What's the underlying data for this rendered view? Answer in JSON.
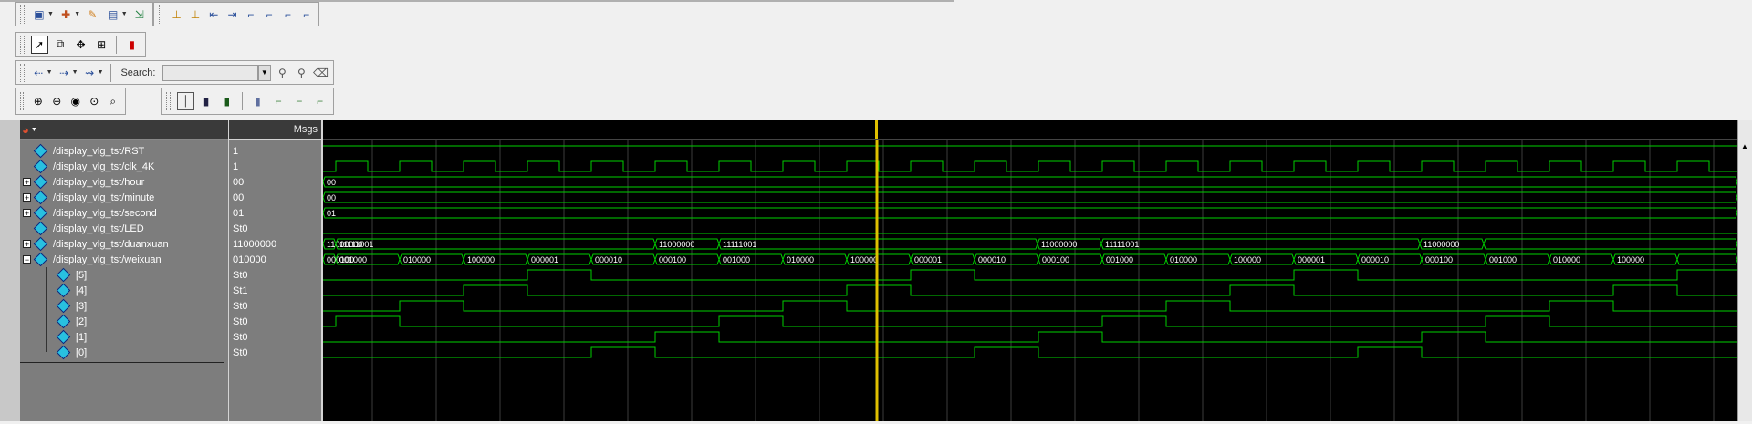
{
  "toolbars": {
    "row1_icons": [
      "new-wave-icon",
      "add-signal-icon",
      "edit-icon",
      "group-icon",
      "insert-icon",
      "cursor-add-icon",
      "cursor-delete-icon",
      "cursor-prev-icon",
      "cursor-next-icon",
      "edge-a-icon",
      "edge-b-icon",
      "edge-c-icon",
      "edge-d-icon"
    ],
    "row2_icons": [
      "select-pointer-icon",
      "zoom-mode-icon",
      "pan-mode-icon",
      "measure-icon",
      "stop-run-icon"
    ],
    "search_label": "Search:",
    "search_value": ""
  },
  "wave": {
    "msgs_header": "Msgs",
    "signals": [
      {
        "name": "/display_vlg_tst/RST",
        "value": "1",
        "expandable": false,
        "indent": 0
      },
      {
        "name": "/display_vlg_tst/clk_4K",
        "value": "1",
        "expandable": false,
        "indent": 0
      },
      {
        "name": "/display_vlg_tst/hour",
        "value": "00",
        "expandable": true,
        "expanded": false,
        "indent": 0
      },
      {
        "name": "/display_vlg_tst/minute",
        "value": "00",
        "expandable": true,
        "expanded": false,
        "indent": 0
      },
      {
        "name": "/display_vlg_tst/second",
        "value": "01",
        "expandable": true,
        "expanded": false,
        "indent": 0
      },
      {
        "name": "/display_vlg_tst/LED",
        "value": "St0",
        "expandable": false,
        "indent": 0
      },
      {
        "name": "/display_vlg_tst/duanxuan",
        "value": "11000000",
        "expandable": true,
        "expanded": false,
        "indent": 0
      },
      {
        "name": "/display_vlg_tst/weixuan",
        "value": "010000",
        "expandable": true,
        "expanded": true,
        "indent": 0
      },
      {
        "name": "[5]",
        "value": "St0",
        "expandable": false,
        "indent": 1
      },
      {
        "name": "[4]",
        "value": "St1",
        "expandable": false,
        "indent": 1
      },
      {
        "name": "[3]",
        "value": "St0",
        "expandable": false,
        "indent": 1
      },
      {
        "name": "[2]",
        "value": "St0",
        "expandable": false,
        "indent": 1
      },
      {
        "name": "[1]",
        "value": "St0",
        "expandable": false,
        "indent": 1
      },
      {
        "name": "[0]",
        "value": "St0",
        "expandable": false,
        "indent": 1
      }
    ],
    "bus_labels": {
      "hour": [
        "00"
      ],
      "minute": [
        "00"
      ],
      "second": [
        "01"
      ],
      "duanxuan": [
        "11000000",
        "11111001",
        "11000000",
        "11111001",
        "11000000",
        "11111001",
        "11000000"
      ],
      "weixuan": [
        "000100",
        "001000",
        "010000",
        "100000",
        "000001",
        "000010",
        "000100",
        "001000",
        "010000",
        "100000",
        "000001",
        "000010",
        "000100",
        "001000",
        "010000",
        "100000",
        "000001",
        "000010",
        "000100",
        "001000",
        "010000",
        "100000"
      ]
    },
    "colors": {
      "signal": "#00d000",
      "cursor": "#e0c000",
      "grid": "#3c3c3c",
      "diamond": "#28c0e0"
    }
  }
}
